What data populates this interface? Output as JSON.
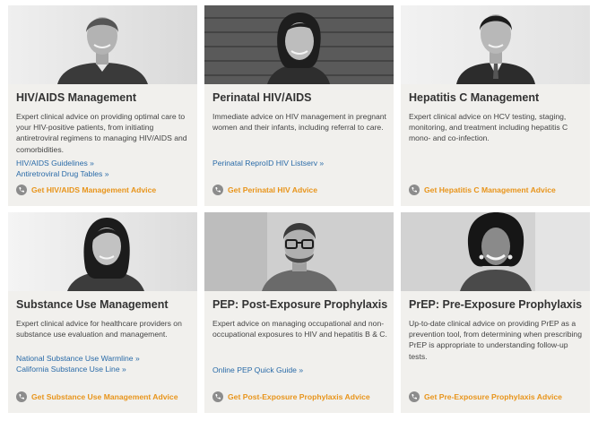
{
  "cards": [
    {
      "title": "HIV/AIDS Management",
      "description": "Expert clinical advice on providing optimal care to your HIV-positive patients, from initiating antiretroviral regimens to managing HIV/AIDS and comorbidities.",
      "links": [
        "HIV/AIDS Guidelines »",
        "Antiretroviral Drug Tables »"
      ],
      "cta": "Get HIV/AIDS Management Advice",
      "photo_icon": "portrait-man-icon"
    },
    {
      "title": "Perinatal HIV/AIDS",
      "description": "Immediate advice on HIV management in pregnant women and their infants, including referral to care.",
      "links": [
        "Perinatal ReproID HIV Listserv »"
      ],
      "cta": "Get Perinatal HIV Advice",
      "photo_icon": "portrait-woman-icon"
    },
    {
      "title": "Hepatitis C Management",
      "description": "Expert clinical advice on HCV testing, staging, monitoring, and treatment including hepatitis C mono- and co-infection.",
      "links": [],
      "cta": "Get Hepatitis C Management Advice",
      "photo_icon": "portrait-man-icon"
    },
    {
      "title": "Substance Use Management",
      "description": "Expert clinical advice for healthcare providers on substance use evaluation and management.",
      "links": [
        "National Substance Use Warmline »",
        "California Substance Use Line »"
      ],
      "cta": "Get Substance Use Management Advice",
      "photo_icon": "portrait-woman-icon"
    },
    {
      "title": "PEP: Post-Exposure Prophylaxis",
      "description": "Expert advice on managing occupational and non-occupational exposures to HIV and hepatitis B & C.",
      "links": [
        "Online PEP Quick Guide »"
      ],
      "cta": "Get Post-Exposure Prophylaxis Advice",
      "photo_icon": "portrait-man-glasses-icon"
    },
    {
      "title": "PrEP: Pre-Exposure Prophylaxis",
      "description": "Up-to-date clinical advice on providing PrEP as a prevention tool, from determining when prescribing PrEP is appropriate to understanding follow-up tests.",
      "links": [],
      "cta": "Get Pre-Exposure Prophylaxis Advice",
      "photo_icon": "portrait-woman-icon"
    }
  ],
  "colors": {
    "card_bg": "#f1f0ed",
    "title": "#333333",
    "body": "#444444",
    "link": "#2a6ba8",
    "cta": "#e8941a",
    "phone_icon": "#8c8c8c"
  }
}
